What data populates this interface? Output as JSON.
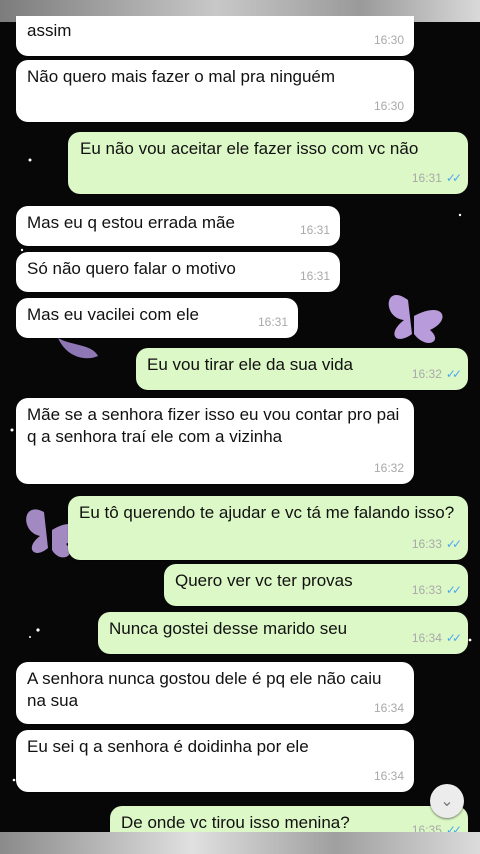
{
  "messages": [
    {
      "text": "assim",
      "time": "16:30"
    },
    {
      "text": "Não quero mais fazer o mal pra ninguém",
      "time": "16:30"
    },
    {
      "text": "Eu não vou aceitar ele fazer isso com vc não",
      "time": "16:31"
    },
    {
      "text": "Mas eu q estou errada mãe",
      "time": "16:31"
    },
    {
      "text": "Só não quero falar o motivo",
      "time": "16:31"
    },
    {
      "text": "Mas eu vacilei com ele",
      "time": "16:31"
    },
    {
      "text": "Eu vou tirar ele da sua vida",
      "time": "16:32"
    },
    {
      "text": "Mãe se a senhora fizer isso eu vou contar pro pai q a senhora traí ele com a vizinha",
      "time": "16:32"
    },
    {
      "text": "Eu tô querendo te ajudar e vc tá me falando isso?",
      "time": "16:33"
    },
    {
      "text": "Quero ver vc ter provas",
      "time": "16:33"
    },
    {
      "text": "Nunca gostei desse marido seu",
      "time": "16:34"
    },
    {
      "text": "A senhora nunca gostou dele é pq ele não caiu na sua",
      "time": "16:34"
    },
    {
      "text": "Eu sei q a senhora é doidinha por ele",
      "time": "16:34"
    },
    {
      "text": "De onde vc tirou isso menina?",
      "time": "16:35"
    }
  ],
  "read_receipt_icon": "double-check-icon",
  "scroll_down_icon": "chevron-down-icon",
  "colors": {
    "incoming_bubble": "#ffffff",
    "outgoing_bubble": "#dcf8c6",
    "read_ticks": "#4fa7f0",
    "background": "#070707"
  }
}
